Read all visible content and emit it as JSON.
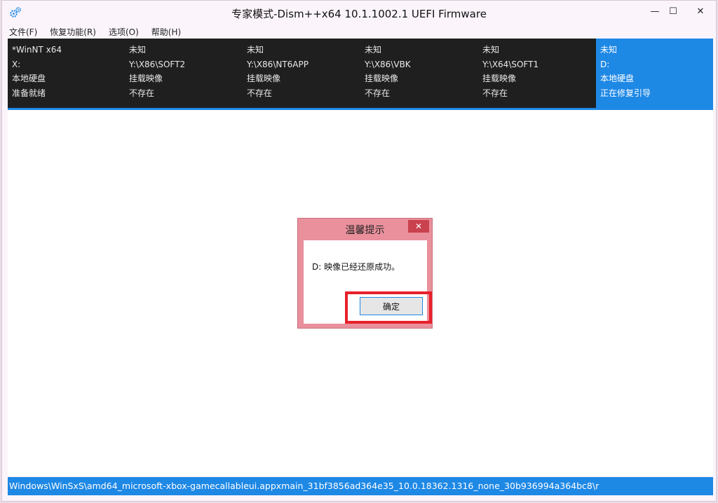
{
  "window": {
    "title": "专家模式-Dism++x64 10.1.1002.1 UEFI Firmware",
    "controls": {
      "minimize": "—",
      "maximize": "☐",
      "close": "✕"
    }
  },
  "menu": {
    "items": [
      {
        "label": "文件(F)"
      },
      {
        "label": "恢复功能(R)"
      },
      {
        "label": "选项(O)"
      },
      {
        "label": "帮助(H)"
      }
    ]
  },
  "sessions": [
    {
      "name": "*WinNT x64",
      "path": "X:",
      "type": "本地硬盘",
      "status": "准备就绪",
      "active": false
    },
    {
      "name": "未知",
      "path": "Y:\\X86\\SOFT2",
      "type": "挂载映像",
      "status": "不存在",
      "active": false
    },
    {
      "name": "未知",
      "path": "Y:\\X86\\NT6APP",
      "type": "挂载映像",
      "status": "不存在",
      "active": false
    },
    {
      "name": "未知",
      "path": "Y:\\X86\\VBK",
      "type": "挂载映像",
      "status": "不存在",
      "active": false
    },
    {
      "name": "未知",
      "path": "Y:\\X64\\SOFT1",
      "type": "挂载映像",
      "status": "不存在",
      "active": false
    },
    {
      "name": "未知",
      "path": "D:",
      "type": "本地硬盘",
      "status": "正在修复引导",
      "active": true
    }
  ],
  "dialog": {
    "title": "温馨提示",
    "close_icon": "✕",
    "message": "D: 映像已经还原成功。",
    "ok_label": "确定"
  },
  "status": {
    "text": "Windows\\WinSxS\\amd64_microsoft-xbox-gamecallableui.appxmain_31bf3856ad364e35_10.0.18362.1316_none_30b936994a364bc8\\r"
  },
  "colors": {
    "accent": "#1e88e5",
    "session_bar_bg": "#1f1f1f",
    "dialog_frame": "#e9909c",
    "highlight": "#e8202a"
  }
}
